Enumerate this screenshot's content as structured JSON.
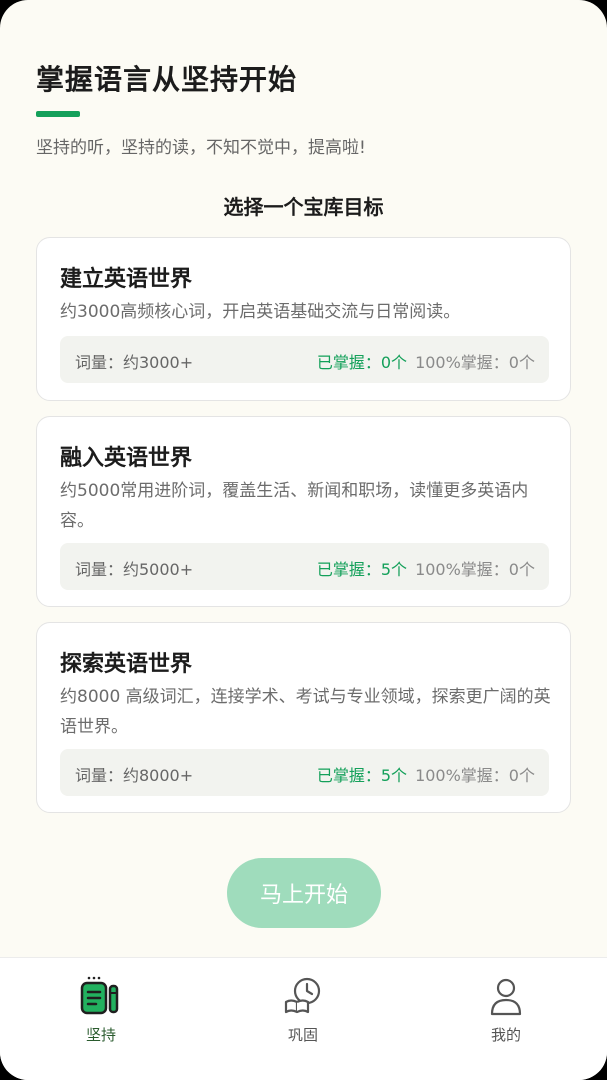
{
  "header": {
    "title": "掌握语言从坚持开始",
    "subtitle": "坚持的听，坚持的读，不知不觉中，提高啦!",
    "accent_color": "#14a05a"
  },
  "section_title": "选择一个宝库目标",
  "cards": [
    {
      "title": "建立英语世界",
      "description": "约3000高频核心词，开启英语基础交流与日常阅读。",
      "vocab": "词量：约3000+",
      "mastered": "已掌握：0个",
      "full_mastered": "100%掌握：0个"
    },
    {
      "title": "融入英语世界",
      "description": "约5000常用进阶词，覆盖生活、新闻和职场，读懂更多英语内容。",
      "vocab": "词量：约5000+",
      "mastered": "已掌握：5个",
      "full_mastered": "100%掌握：0个"
    },
    {
      "title": "探索英语世界",
      "description": "约8000 高级词汇，连接学术、考试与专业领域，探索更广阔的英语世界。",
      "vocab": "词量：约8000+",
      "mastered": "已掌握：5个",
      "full_mastered": "100%掌握：0个"
    }
  ],
  "start_button": {
    "label": "马上开始",
    "color": "#9fdcbc"
  },
  "tabbar": {
    "tabs": [
      {
        "label": "坚持",
        "icon": "notebook-pencil-icon",
        "active": true
      },
      {
        "label": "巩固",
        "icon": "book-clock-icon",
        "active": false
      },
      {
        "label": "我的",
        "icon": "person-icon",
        "active": false
      }
    ]
  }
}
